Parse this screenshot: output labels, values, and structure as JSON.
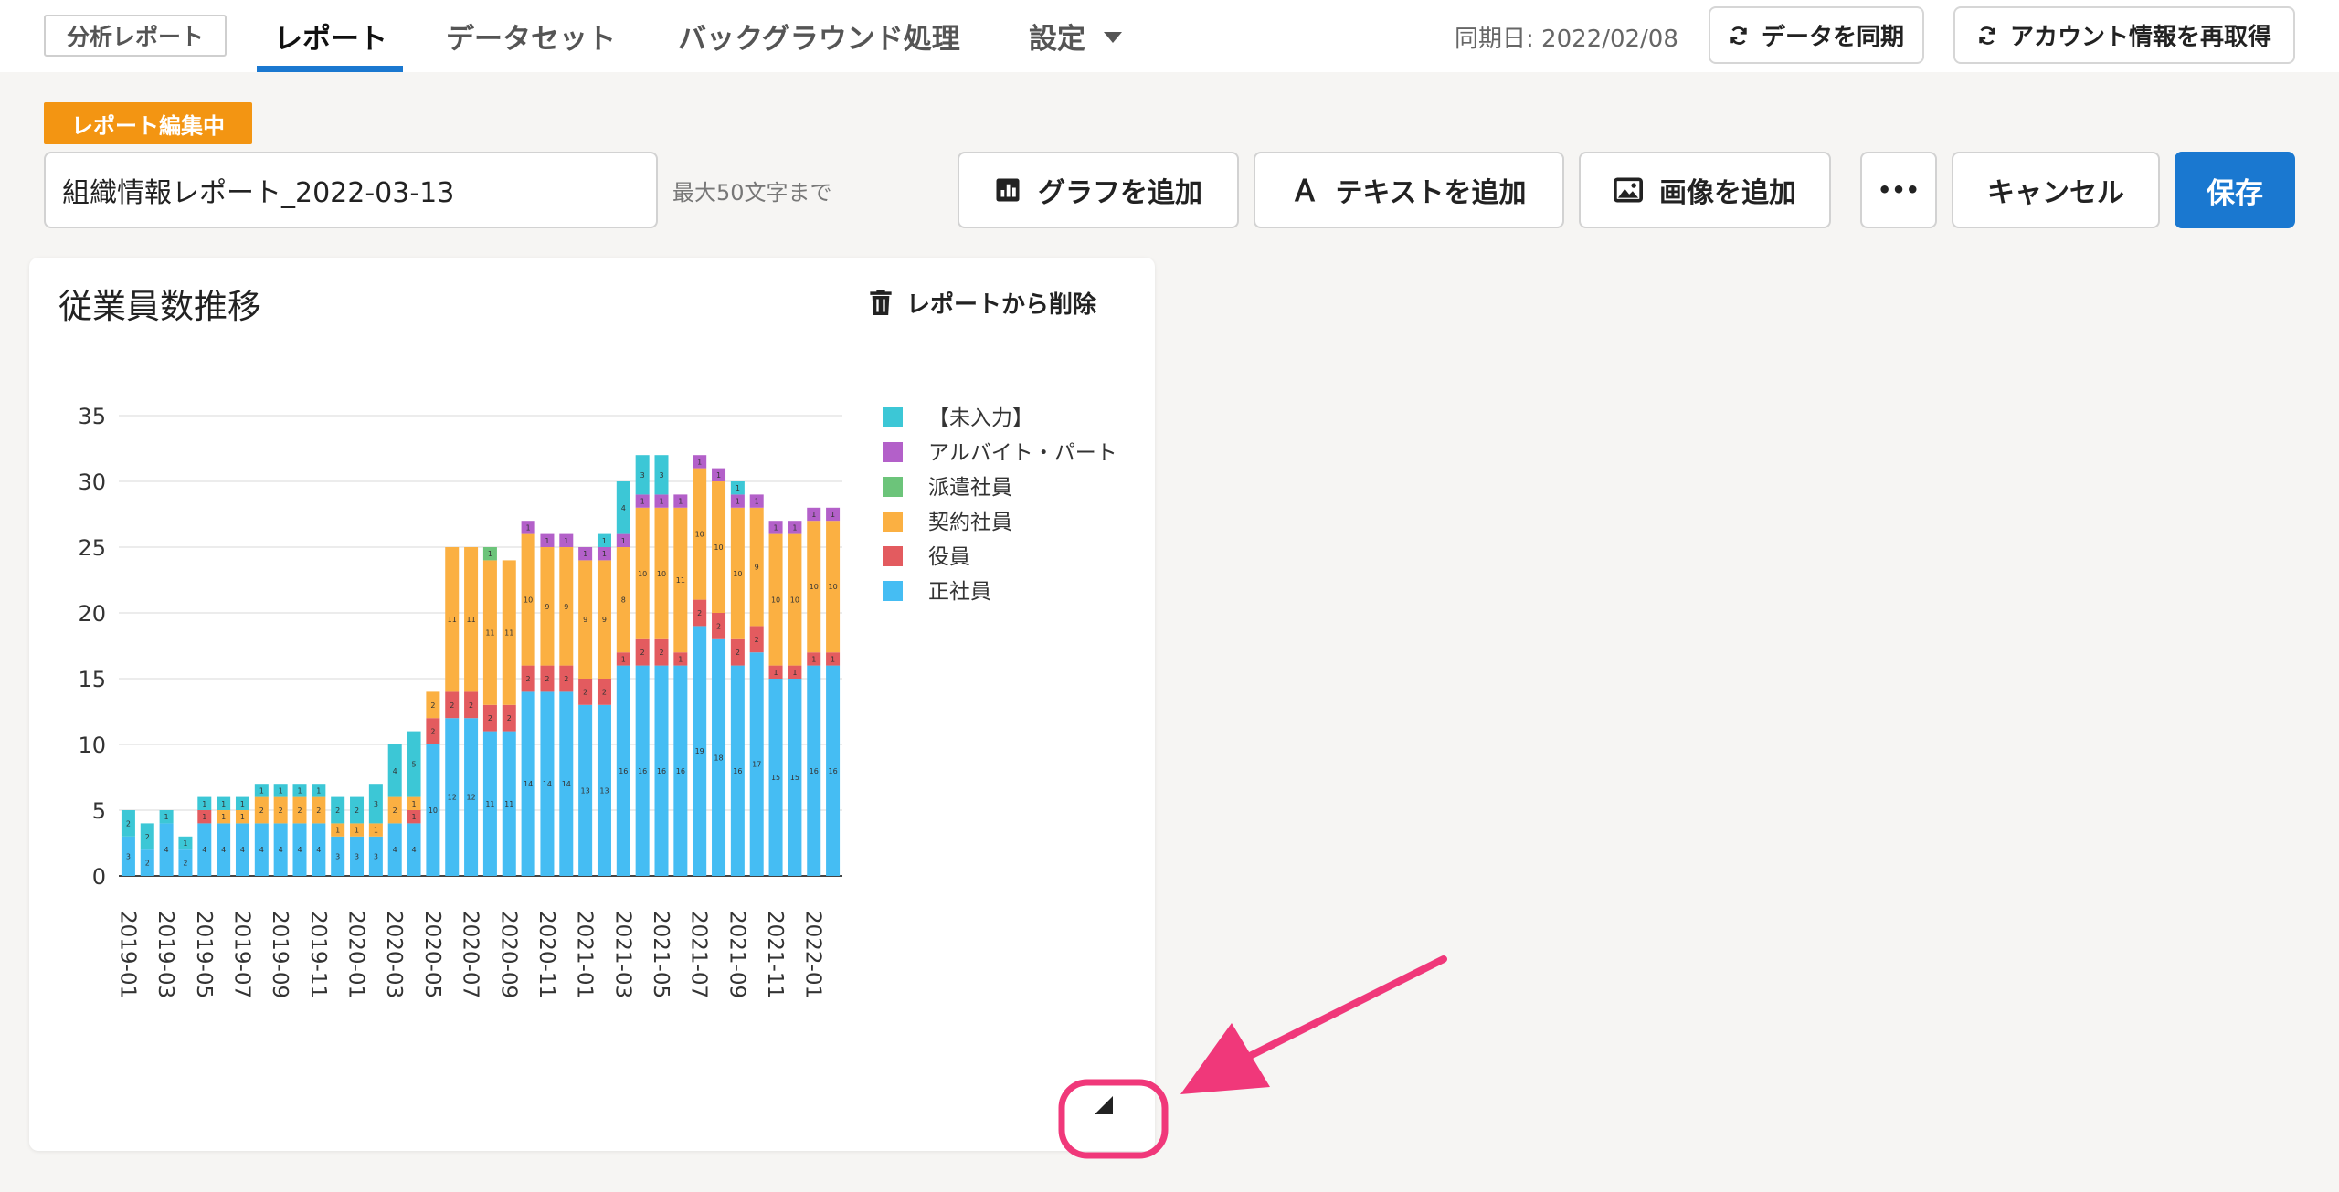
{
  "nav": {
    "brand": "分析レポート",
    "tabs": [
      {
        "label": "レポート"
      },
      {
        "label": "データセット"
      },
      {
        "label": "バックグラウンド処理"
      },
      {
        "label": "設定"
      }
    ],
    "sync_date": "同期日: 2022/02/08",
    "sync_button": "データを同期",
    "refetch_button": "アカウント情報を再取得"
  },
  "editor": {
    "badge": "レポート編集中",
    "title_value": "組織情報レポート_2022-03-13",
    "title_hint": "最大50文字まで",
    "add_chart": "グラフを追加",
    "add_text": "テキストを追加",
    "add_image": "画像を追加",
    "more": "•••",
    "cancel": "キャンセル",
    "save": "保存"
  },
  "card": {
    "title": "従業員数推移",
    "delete_label": "レポートから削除"
  },
  "colors": {
    "accent": "#1a78d0",
    "badge": "#f39512",
    "annotation": "#f0387a"
  },
  "chart_data": {
    "type": "bar",
    "stacked": true,
    "ylim": [
      0,
      35
    ],
    "yticks": [
      0,
      5,
      10,
      15,
      20,
      25,
      30,
      35
    ],
    "xticks_shown": [
      "2019-01",
      "2019-03",
      "2019-05",
      "2019-07",
      "2019-09",
      "2019-11",
      "2020-01",
      "2020-03",
      "2020-05",
      "2020-07",
      "2020-09",
      "2020-11",
      "2021-01",
      "2021-03",
      "2021-05",
      "2021-07",
      "2021-09",
      "2021-11",
      "2022-01"
    ],
    "categories": [
      "2019-01",
      "2019-02",
      "2019-03",
      "2019-04",
      "2019-05",
      "2019-06",
      "2019-07",
      "2019-08",
      "2019-09",
      "2019-10",
      "2019-11",
      "2019-12",
      "2020-01",
      "2020-02",
      "2020-03",
      "2020-04",
      "2020-05",
      "2020-06",
      "2020-07",
      "2020-08",
      "2020-09",
      "2020-10",
      "2020-11",
      "2020-12",
      "2021-01",
      "2021-02",
      "2021-03",
      "2021-04",
      "2021-05",
      "2021-06",
      "2021-07",
      "2021-08",
      "2021-09",
      "2021-10",
      "2021-11",
      "2021-12",
      "2022-01",
      "2022-02"
    ],
    "legend_position": "right",
    "grid": true,
    "series": [
      {
        "name": "正社員",
        "color": "#45bdf3",
        "values": [
          3,
          2,
          4,
          2,
          4,
          4,
          4,
          4,
          4,
          4,
          4,
          3,
          3,
          3,
          4,
          4,
          10,
          12,
          12,
          11,
          11,
          14,
          14,
          14,
          13,
          13,
          16,
          16,
          16,
          16,
          19,
          18,
          16,
          17,
          15,
          15,
          16,
          16
        ]
      },
      {
        "name": "役員",
        "color": "#e35b5f",
        "values": [
          0,
          0,
          0,
          0,
          1,
          0,
          0,
          0,
          0,
          0,
          0,
          0,
          0,
          0,
          0,
          1,
          2,
          2,
          2,
          2,
          2,
          2,
          2,
          2,
          2,
          2,
          1,
          2,
          2,
          1,
          2,
          2,
          2,
          2,
          1,
          1,
          1,
          1
        ]
      },
      {
        "name": "契約社員",
        "color": "#fbb042",
        "values": [
          0,
          0,
          0,
          0,
          0,
          1,
          1,
          2,
          2,
          2,
          2,
          1,
          1,
          1,
          2,
          1,
          2,
          11,
          11,
          11,
          11,
          10,
          9,
          9,
          9,
          9,
          8,
          10,
          10,
          11,
          10,
          10,
          10,
          9,
          10,
          10,
          10,
          10
        ]
      },
      {
        "name": "派遣社員",
        "color": "#6cc47a",
        "values": [
          0,
          0,
          0,
          0,
          0,
          0,
          0,
          0,
          0,
          0,
          0,
          0,
          0,
          0,
          0,
          0,
          0,
          0,
          0,
          1,
          0,
          0,
          0,
          0,
          0,
          0,
          0,
          0,
          0,
          0,
          0,
          0,
          0,
          0,
          0,
          0,
          0,
          0
        ]
      },
      {
        "name": "アルバイト・パート",
        "color": "#b360c9",
        "values": [
          0,
          0,
          0,
          0,
          0,
          0,
          0,
          0,
          0,
          0,
          0,
          0,
          0,
          0,
          0,
          0,
          0,
          0,
          0,
          0,
          0,
          1,
          1,
          1,
          1,
          1,
          1,
          1,
          1,
          1,
          1,
          1,
          1,
          1,
          1,
          1,
          1,
          1
        ]
      },
      {
        "name": "【未入力】",
        "color": "#3cc7d6",
        "values": [
          2,
          2,
          1,
          1,
          1,
          1,
          1,
          1,
          1,
          1,
          1,
          2,
          2,
          3,
          4,
          5,
          0,
          0,
          0,
          0,
          0,
          0,
          0,
          0,
          0,
          1,
          4,
          3,
          3,
          0,
          0,
          0,
          1,
          0,
          0,
          0,
          0,
          0
        ]
      }
    ]
  }
}
